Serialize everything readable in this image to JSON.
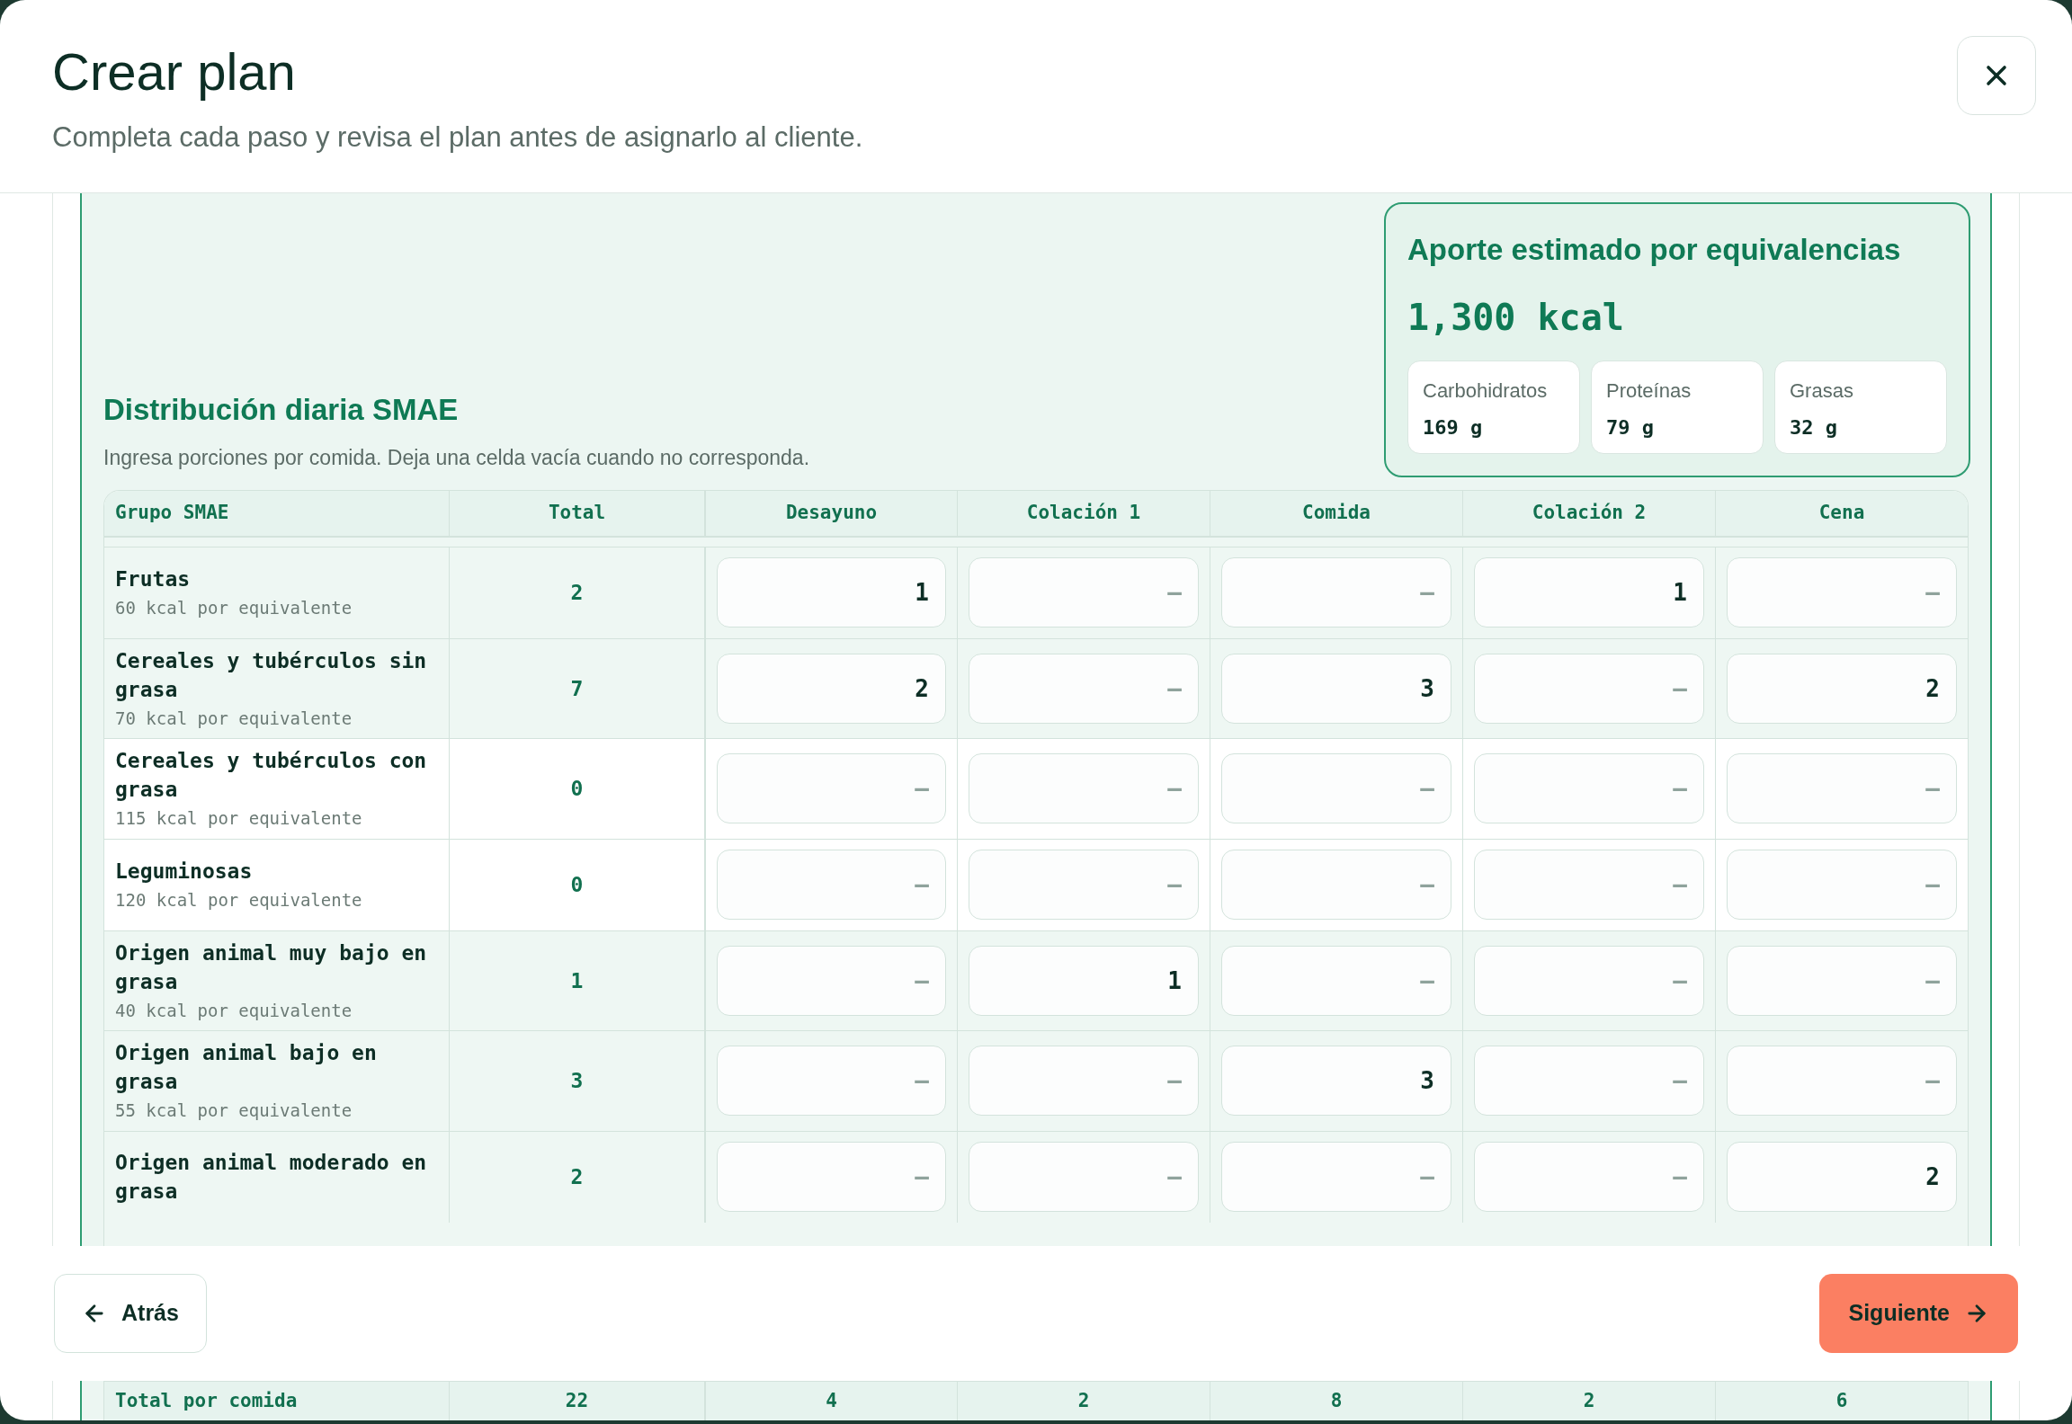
{
  "dialog": {
    "title": "Crear plan",
    "subtitle": "Completa cada paso y revisa el plan antes de asignarlo al cliente."
  },
  "section": {
    "title": "Distribución diaria SMAE",
    "description": "Ingresa porciones por comida. Deja una celda vacía cuando no corresponda."
  },
  "summary": {
    "title": "Aporte estimado por equivalencias",
    "total": "1,300 kcal",
    "macros": [
      {
        "label": "Carbohidratos",
        "value": "169 g"
      },
      {
        "label": "Proteínas",
        "value": "79 g"
      },
      {
        "label": "Grasas",
        "value": "32 g"
      }
    ]
  },
  "table": {
    "columns": [
      "Grupo SMAE",
      "Total",
      "Desayuno",
      "Colación 1",
      "Comida",
      "Colación 2",
      "Cena"
    ],
    "rows": [
      {
        "name": "Frutas",
        "kcal": "60 kcal por equivalente",
        "total": "2",
        "highlighted": true,
        "cells": [
          {
            "value": "1"
          },
          {
            "placeholder": "–"
          },
          {
            "placeholder": "–"
          },
          {
            "value": "1"
          },
          {
            "placeholder": "–"
          }
        ]
      },
      {
        "name": "Cereales y tubérculos sin grasa",
        "kcal": "70 kcal por equivalente",
        "total": "7",
        "highlighted": true,
        "cells": [
          {
            "value": "2"
          },
          {
            "placeholder": "–"
          },
          {
            "value": "3"
          },
          {
            "placeholder": "–"
          },
          {
            "value": "2"
          }
        ]
      },
      {
        "name": "Cereales y tubérculos con grasa",
        "kcal": "115 kcal por equivalente",
        "total": "0",
        "highlighted": false,
        "cells": [
          {
            "placeholder": "–"
          },
          {
            "placeholder": "–"
          },
          {
            "placeholder": "–"
          },
          {
            "placeholder": "–"
          },
          {
            "placeholder": "–"
          }
        ]
      },
      {
        "name": "Leguminosas",
        "kcal": "120 kcal por equivalente",
        "total": "0",
        "highlighted": false,
        "cells": [
          {
            "placeholder": "–"
          },
          {
            "placeholder": "–"
          },
          {
            "placeholder": "–"
          },
          {
            "placeholder": "–"
          },
          {
            "placeholder": "–"
          }
        ]
      },
      {
        "name": "Origen animal muy bajo en grasa",
        "kcal": "40 kcal por equivalente",
        "total": "1",
        "highlighted": true,
        "cells": [
          {
            "placeholder": "–"
          },
          {
            "value": "1"
          },
          {
            "placeholder": "–"
          },
          {
            "placeholder": "–"
          },
          {
            "placeholder": "–"
          }
        ]
      },
      {
        "name": "Origen animal bajo en grasa",
        "kcal": "55 kcal por equivalente",
        "total": "3",
        "highlighted": true,
        "cells": [
          {
            "placeholder": "–"
          },
          {
            "placeholder": "–"
          },
          {
            "value": "3"
          },
          {
            "placeholder": "–"
          },
          {
            "placeholder": "–"
          }
        ]
      },
      {
        "name": "Origen animal moderado en grasa",
        "total": "2",
        "highlighted": true,
        "cells": [
          {
            "placeholder": "–"
          },
          {
            "placeholder": "–"
          },
          {
            "placeholder": "–"
          },
          {
            "placeholder": "–"
          },
          {
            "value": "2"
          }
        ]
      }
    ],
    "totals": {
      "label": "Total por comida",
      "values": [
        "22",
        "4",
        "2",
        "8",
        "2",
        "6"
      ]
    }
  },
  "footer": {
    "back": "Atrás",
    "next": "Siguiente"
  }
}
